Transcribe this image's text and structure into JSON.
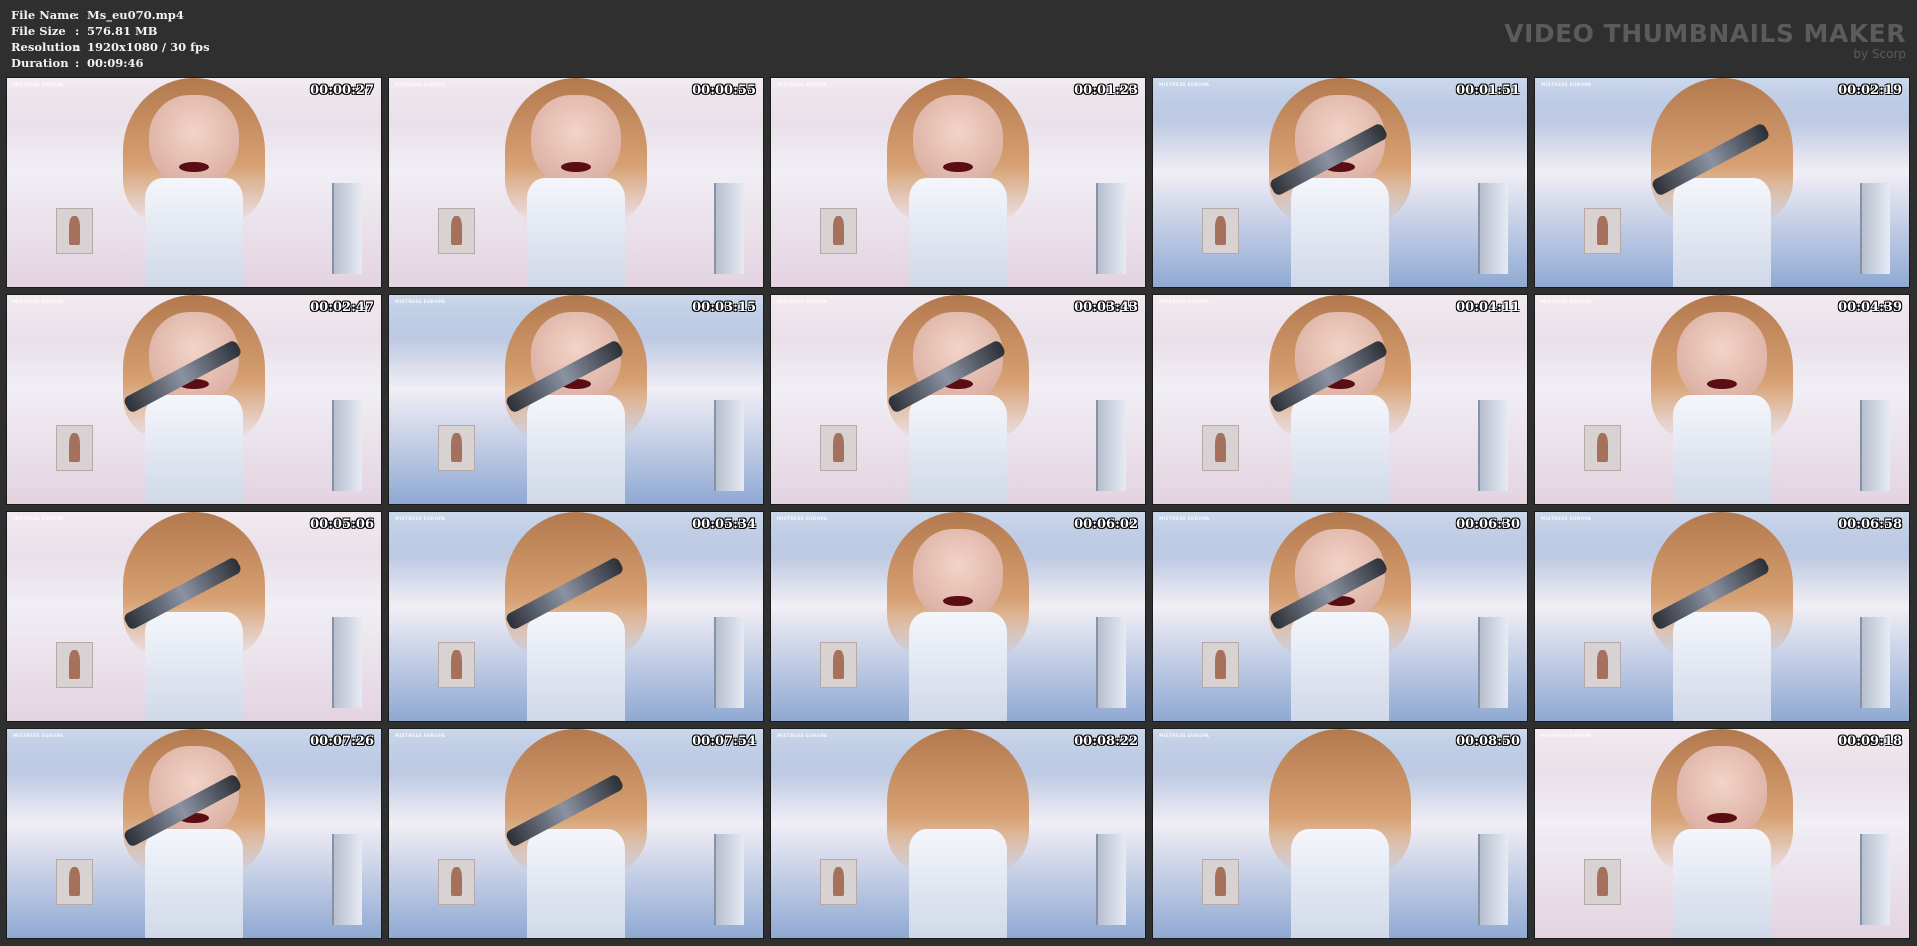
{
  "info": {
    "rows": [
      {
        "key": "File Name",
        "sep": ":",
        "value": "Ms_eu070.mp4"
      },
      {
        "key": "File Size",
        "sep": ":",
        "value": "576.81 MB"
      },
      {
        "key": "Resolution",
        "sep": ":",
        "value": "1920x1080 / 30 fps"
      },
      {
        "key": "Duration",
        "sep": ":",
        "value": "00:09:46"
      }
    ]
  },
  "brand": {
    "title": "VIDEO THUMBNAILS MAKER",
    "subtitle": "by Scorp"
  },
  "thumbnails": [
    {
      "time": "00:00:27",
      "watermark": "MISTRESS EUROPA",
      "tone": "pink"
    },
    {
      "time": "00:00:55",
      "watermark": "MISTRESS EUROPA",
      "tone": "pink"
    },
    {
      "time": "00:01:23",
      "watermark": "MISTRESS EUROPA",
      "tone": "pink"
    },
    {
      "time": "00:01:51",
      "watermark": "MISTRESS EUROPA",
      "tone": "blue"
    },
    {
      "time": "00:02:19",
      "watermark": "MISTRESS EUROPA",
      "tone": "blue"
    },
    {
      "time": "00:02:47",
      "watermark": "MISTRESS EUROPA",
      "tone": "pink"
    },
    {
      "time": "00:03:15",
      "watermark": "MISTRESS EUROPA",
      "tone": "blue"
    },
    {
      "time": "00:03:43",
      "watermark": "MISTRESS EUROPA",
      "tone": "pink"
    },
    {
      "time": "00:04:11",
      "watermark": "MISTRESS EUROPA",
      "tone": "pink"
    },
    {
      "time": "00:04:39",
      "watermark": "MISTRESS EUROPA",
      "tone": "pink"
    },
    {
      "time": "00:05:06",
      "watermark": "MISTRESS EUROPA",
      "tone": "pink"
    },
    {
      "time": "00:05:34",
      "watermark": "MISTRESS EUROPA",
      "tone": "blue"
    },
    {
      "time": "00:06:02",
      "watermark": "MISTRESS EUROPA",
      "tone": "blue"
    },
    {
      "time": "00:06:30",
      "watermark": "MISTRESS EUROPA",
      "tone": "blue"
    },
    {
      "time": "00:06:58",
      "watermark": "MISTRESS EUROPA",
      "tone": "blue"
    },
    {
      "time": "00:07:26",
      "watermark": "MISTRESS EUROPA",
      "tone": "blue"
    },
    {
      "time": "00:07:54",
      "watermark": "MISTRESS EUROPA",
      "tone": "blue"
    },
    {
      "time": "00:08:22",
      "watermark": "MISTRESS EUROPA",
      "tone": "blue"
    },
    {
      "time": "00:08:50",
      "watermark": "MISTRESS EUROPA",
      "tone": "blue"
    },
    {
      "time": "00:09:18",
      "watermark": "MISTRESS EUROPA",
      "tone": "pink"
    }
  ],
  "colors": {
    "background": "#2f2f2f",
    "brand_text": "#5b5b5b",
    "tone_pink": "#e3d3e0",
    "tone_blue": "#8fa9d3"
  }
}
